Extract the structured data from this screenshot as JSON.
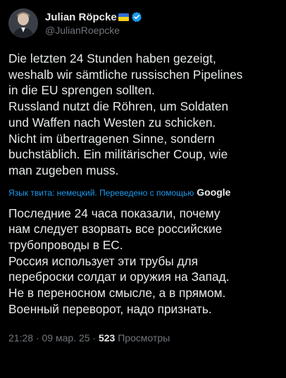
{
  "author": {
    "display_name": "Julian Röpcke",
    "handle": "@JulianRoepcke",
    "flag_icon": "ukraine-flag-icon",
    "verified_icon": "verified-badge-icon",
    "verified_color": "#1d9bf0"
  },
  "tweet": {
    "original_text": "Die letzten 24 Stunden haben gezeigt,\nweshalb wir sämtliche russischen Pipelines\nin die EU sprengen sollten.\nRussland nutzt die Röhren, um Soldaten\nund Waffen nach Westen zu schicken.\nNicht im übertragenen Sinne, sondern\nbuchstäblich. Ein militärischer Coup, wie\nman zugeben muss.",
    "translation_note": "Язык твита: немецкий. Переведено с помощью",
    "translation_provider": "Google",
    "translated_text": "Последние 24 часа показали, почему\nнам следует взорвать все российские\nтрубопроводы в ЕС.\nРоссия использует эти трубы для\nпереброски солдат и оружия на Запад.\nНе в переносном смысле, а в прямом.\nВоенный переворот, надо признать."
  },
  "meta": {
    "time": "21:28",
    "separator": "·",
    "date": "09 мар. 25",
    "views_count": "523",
    "views_label": "Просмотры"
  }
}
